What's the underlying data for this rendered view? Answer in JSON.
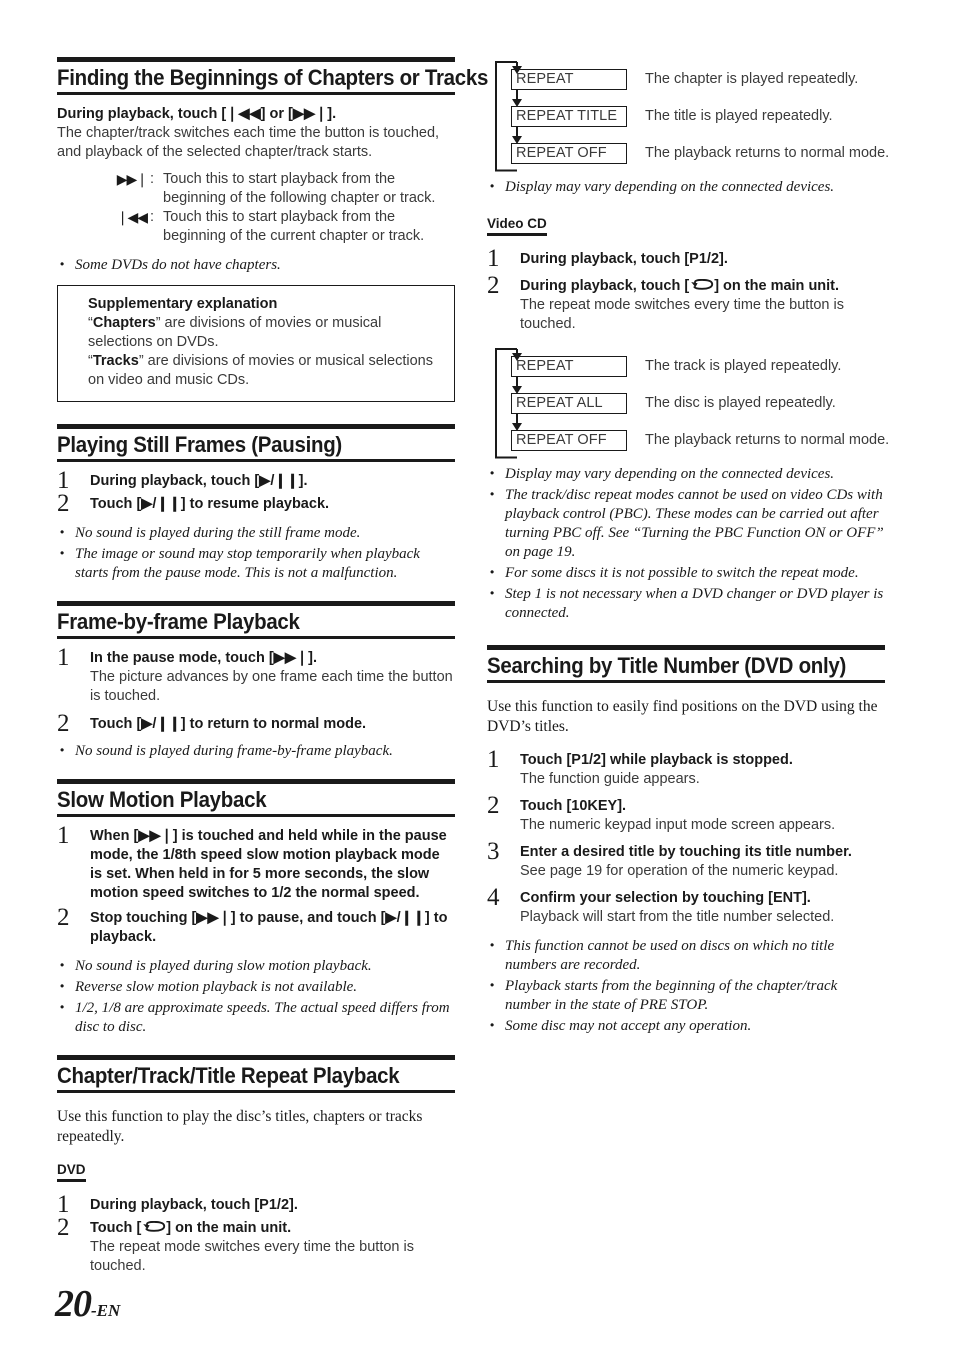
{
  "page": {
    "number": "20",
    "language_suffix": "-EN"
  },
  "icons": {
    "next": "▶▶❘",
    "prev": "❘◀◀",
    "play_pause": "▶/❙❙",
    "repeat": "repeat-loop-icon"
  },
  "left_column": {
    "section_chapters": {
      "title": "Finding the Beginnings of Chapters or Tracks",
      "lead": "During playback, touch [❘◀◀] or [▶▶❘].",
      "body": "The chapter/track switches each time the button is touched, and playback of the selected chapter/track starts.",
      "defs": [
        {
          "glyph": "▶▶❘",
          "glyph_name": "next-track-icon",
          "colon": ":",
          "text": "Touch this to start playback from the beginning of the following chapter or track."
        },
        {
          "glyph": "❘◀◀",
          "glyph_name": "previous-track-icon",
          "colon": ":",
          "text": "Touch this to start playback from the beginning of the current chapter or track."
        }
      ],
      "notes": [
        "Some DVDs do not have chapters."
      ],
      "supplementary": {
        "title": "Supplementary explanation",
        "line1_q1": "“",
        "line1_bold": "Chapters",
        "line1_rest": "” are divisions of movies or musical selections on DVDs.",
        "line2_q1": "“",
        "line2_bold": "Tracks",
        "line2_rest": "” are divisions of movies or musical selections on video and music CDs."
      }
    },
    "section_still": {
      "title": "Playing Still Frames (Pausing)",
      "steps": [
        {
          "num": "1",
          "title": "During playback, touch [▶/❙❙].",
          "desc": ""
        },
        {
          "num": "2",
          "title": "Touch [▶/❙❙] to resume playback.",
          "desc": ""
        }
      ],
      "notes": [
        "No sound is played during the still frame mode.",
        "The image or sound may stop temporarily when playback starts from the pause mode. This is not a malfunction."
      ]
    },
    "section_frame": {
      "title": "Frame-by-frame Playback",
      "steps": [
        {
          "num": "1",
          "title": "In the pause mode, touch [▶▶❘].",
          "desc": "The picture advances by one frame each time the button is touched."
        },
        {
          "num": "2",
          "title": "Touch [▶/❙❙] to return to normal mode.",
          "desc": ""
        }
      ],
      "notes": [
        "No sound is played during frame-by-frame playback."
      ]
    },
    "section_slow": {
      "title": "Slow Motion Playback",
      "steps": [
        {
          "num": "1",
          "title": "When [▶▶❘] is touched and held while in the pause mode, the 1/8th speed slow motion playback mode is set. When held in for 5 more seconds, the slow motion speed switches to 1/2 the normal speed.",
          "desc": ""
        },
        {
          "num": "2",
          "title": "Stop touching [▶▶❘] to pause, and touch [▶/❙❙] to playback.",
          "desc": ""
        }
      ],
      "notes": [
        "No sound is played during slow motion playback.",
        "Reverse slow motion playback is not available.",
        "1/2, 1/8 are approximate speeds. The actual speed differs from disc to disc."
      ]
    },
    "section_repeat": {
      "title": "Chapter/Track/Title Repeat Playback",
      "intro": "Use this function to play the disc’s titles, chapters or tracks repeatedly.",
      "sub_label": "DVD",
      "steps": [
        {
          "num": "1",
          "title": "During playback, touch [P1/2].",
          "desc": ""
        },
        {
          "num": "2",
          "title_pre": "Touch [",
          "title_post": "] on the main unit.",
          "desc": "The repeat mode switches every time the button is touched."
        }
      ]
    }
  },
  "right_column": {
    "dvd_flow": {
      "rows": [
        {
          "box": "REPEAT",
          "desc": "The chapter is played repeatedly."
        },
        {
          "box": "REPEAT TITLE",
          "desc": "The title is played repeatedly."
        },
        {
          "box": "REPEAT OFF",
          "desc": "The playback returns to normal mode."
        }
      ],
      "notes": [
        "Display may vary depending on the connected devices."
      ]
    },
    "videocd": {
      "sub_label": "Video CD",
      "steps": [
        {
          "num": "1",
          "title": "During playback, touch [P1/2].",
          "desc": ""
        },
        {
          "num": "2",
          "title_pre": "During playback, touch [",
          "title_post": "] on the main unit.",
          "desc": "The repeat mode switches every time the button is touched."
        }
      ],
      "flow": {
        "rows": [
          {
            "box": "REPEAT",
            "desc": "The track is played repeatedly."
          },
          {
            "box": "REPEAT ALL",
            "desc": "The disc is played repeatedly."
          },
          {
            "box": "REPEAT OFF",
            "desc": "The playback returns to normal mode."
          }
        ]
      },
      "notes": [
        "Display may vary depending on the connected devices.",
        "The track/disc repeat modes cannot be used on video CDs with playback control (PBC). These modes can be carried out after turning PBC off. See “Turning the PBC Function ON or OFF” on page 19.",
        "For some discs it is not possible to switch the repeat mode.",
        "Step 1 is not necessary when a DVD changer or DVD player is connected."
      ]
    },
    "section_search": {
      "title": "Searching by Title Number (DVD only)",
      "intro": "Use this function to easily find positions on the DVD using the DVD’s titles.",
      "steps": [
        {
          "num": "1",
          "title": "Touch [P1/2] while playback is stopped.",
          "desc": "The function guide appears."
        },
        {
          "num": "2",
          "title": "Touch [10KEY].",
          "desc": "The numeric keypad input mode screen appears."
        },
        {
          "num": "3",
          "title": "Enter a desired title by touching its title number.",
          "desc": "See page 19 for operation of the numeric keypad."
        },
        {
          "num": "4",
          "title": "Confirm your selection by touching [ENT].",
          "desc": "Playback will start from the title number selected."
        }
      ],
      "notes": [
        "This function cannot be used on discs on which no title numbers are recorded.",
        "Playback starts from the beginning of the chapter/track number in the state of PRE STOP.",
        "Some disc may not accept any operation."
      ]
    }
  }
}
